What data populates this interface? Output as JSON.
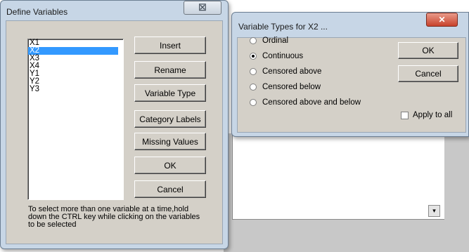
{
  "define_variables": {
    "title": "Define Variables",
    "close_glyph": "☒",
    "variables": [
      "X1",
      "X2",
      "X3",
      "X4",
      "Y1",
      "Y2",
      "Y3"
    ],
    "selected_index": 1,
    "buttons": {
      "insert": "Insert",
      "rename": "Rename",
      "variable_type": "Variable Type",
      "category_labels": "Category Labels",
      "missing_values": "Missing Values",
      "ok": "OK",
      "cancel": "Cancel"
    },
    "hint": "To select more than one variable at a time,hold down the CTRL key while clicking on the variables to be selected"
  },
  "variable_types": {
    "title": "Variable Types for X2 ...",
    "close_glyph": "✕",
    "options": [
      "Ordinal",
      "Continuous",
      "Censored above",
      "Censored below",
      "Censored above and below"
    ],
    "selected_option": "Continuous",
    "ok": "OK",
    "cancel": "Cancel",
    "apply_to_all": "Apply to all",
    "apply_to_all_checked": false
  },
  "background_window": {
    "scroll_glyph": "▾"
  }
}
